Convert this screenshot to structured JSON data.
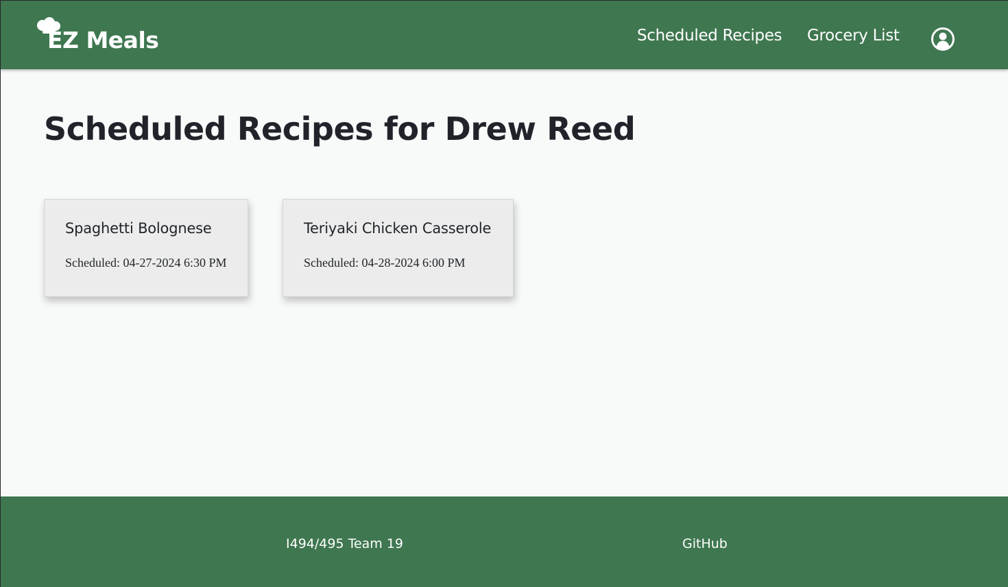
{
  "header": {
    "brand": "EZ Meals",
    "logo_icon": "chef-hat-icon",
    "nav": {
      "scheduled_recipes": "Scheduled Recipes",
      "grocery_list": "Grocery List"
    },
    "account_icon": "user-circle-icon"
  },
  "main": {
    "title": "Scheduled Recipes for Drew Reed",
    "recipes": [
      {
        "name": "Spaghetti Bolognese",
        "scheduled": "Scheduled: 04-27-2024 6:30 PM"
      },
      {
        "name": "Teriyaki Chicken Casserole",
        "scheduled": "Scheduled: 04-28-2024 6:00 PM"
      }
    ]
  },
  "footer": {
    "team": "I494/495 Team 19",
    "github": "GitHub"
  },
  "colors": {
    "brand_green": "#3f7750",
    "background": "#f8f9f9",
    "card_background": "#ececec",
    "text_dark": "#20242a"
  }
}
